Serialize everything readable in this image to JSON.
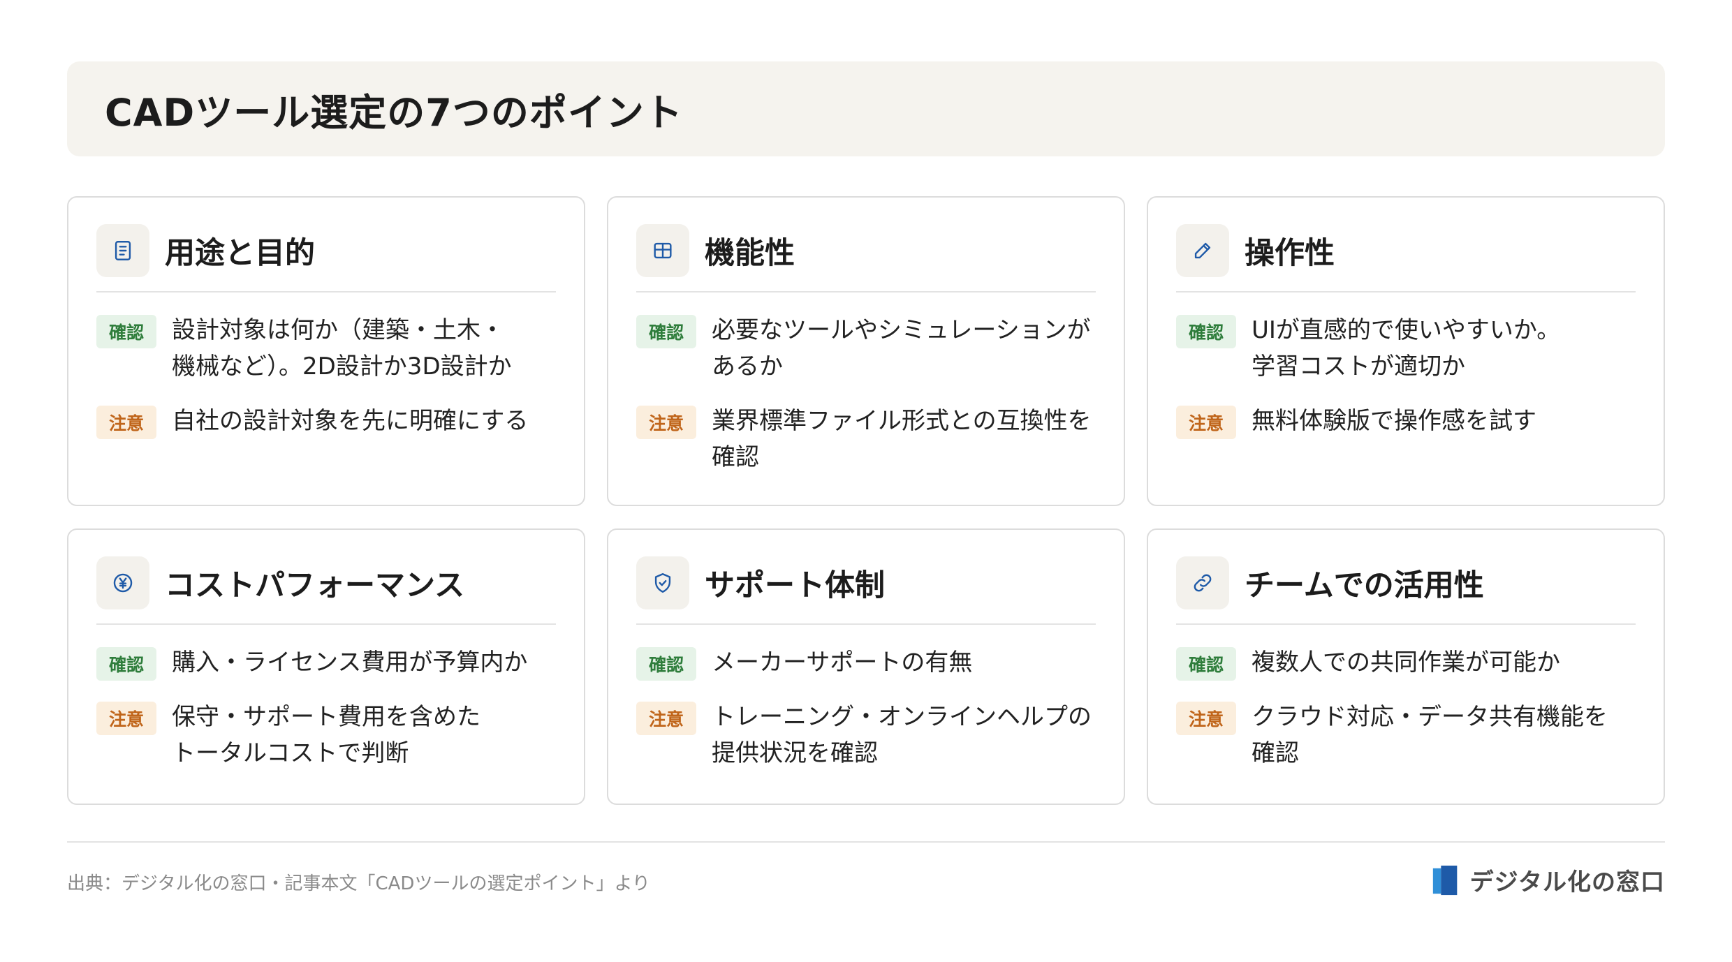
{
  "header": {
    "title": "CADツール選定の7つのポイント"
  },
  "labels": {
    "check": "確認",
    "warn": "注意"
  },
  "cards": [
    {
      "title": "用途と目的",
      "icon": "document-icon",
      "check": "設計対象は何か（建築・土木・\n機械など）。2D設計か3D設計か",
      "warn": "自社の設計対象を先に明確にする"
    },
    {
      "title": "機能性",
      "icon": "table-icon",
      "check": "必要なツールやシミュレーションが\nあるか",
      "warn": "業界標準ファイル形式との互換性を\n確認"
    },
    {
      "title": "操作性",
      "icon": "pencil-icon",
      "check": "UIが直感的で使いやすいか。\n学習コストが適切か",
      "warn": "無料体験版で操作感を試す"
    },
    {
      "title": "コストパフォーマンス",
      "icon": "yen-icon",
      "check": "購入・ライセンス費用が予算内か",
      "warn": "保守・サポート費用を含めた\nトータルコストで判断"
    },
    {
      "title": "サポート体制",
      "icon": "shield-check-icon",
      "check": "メーカーサポートの有無",
      "warn": "トレーニング・オンラインヘルプの\n提供状況を確認"
    },
    {
      "title": "チームでの活用性",
      "icon": "link-icon",
      "check": "複数人での共同作業が可能か",
      "warn": "クラウド対応・データ共有機能を\n確認"
    }
  ],
  "footer": {
    "source": "出典：デジタル化の窓口・記事本文「CADツールの選定ポイント」より",
    "brand": "デジタル化の窓口"
  },
  "colors": {
    "icon_accent": "#1e5aa8",
    "check_text": "#2e7d3b",
    "check_bg": "#e6f3e8",
    "warn_text": "#c0651a",
    "warn_bg": "#fbeedd",
    "header_bg": "#f5f3ee"
  }
}
